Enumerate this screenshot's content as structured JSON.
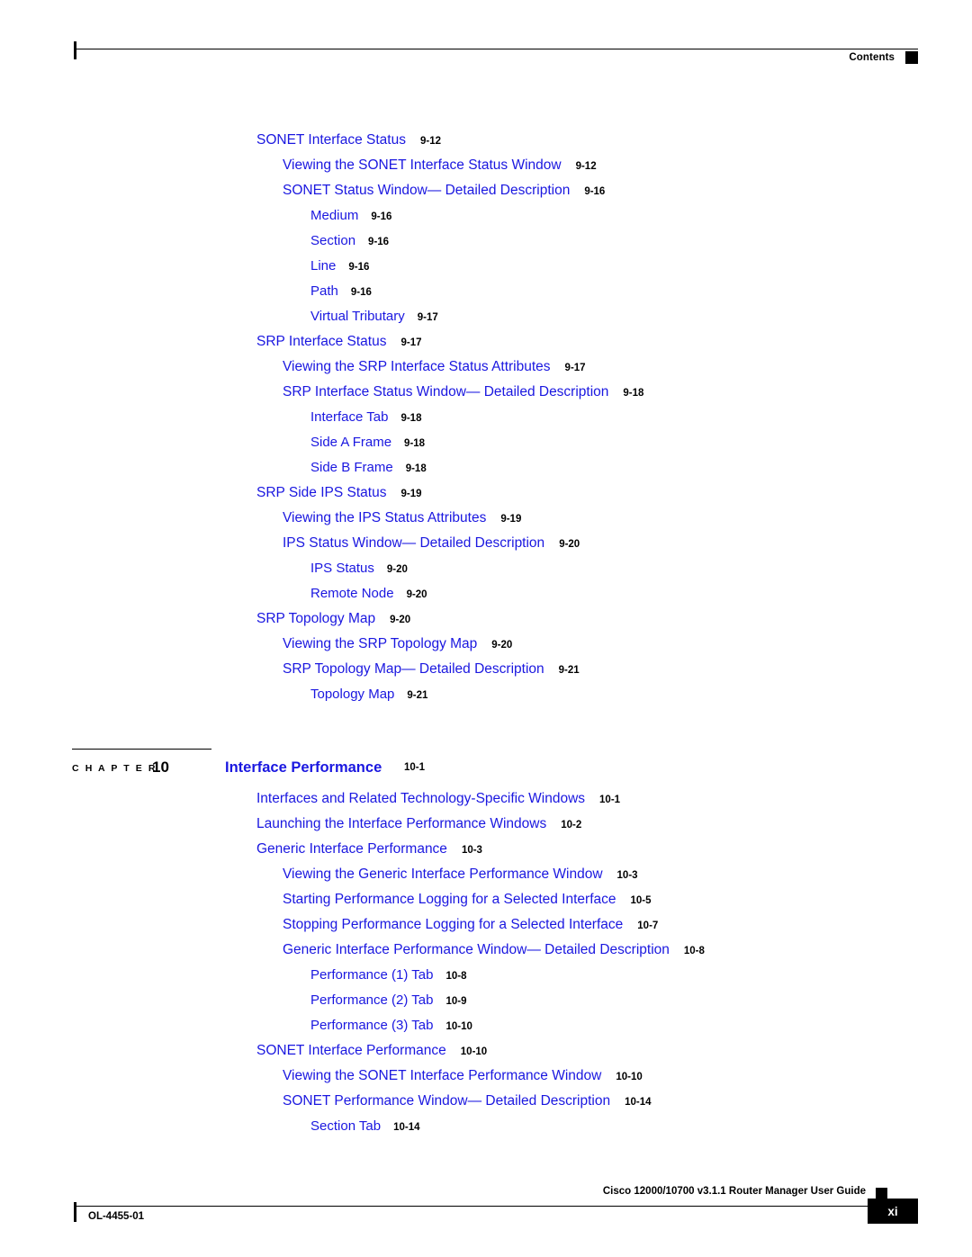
{
  "header": {
    "label": "Contents",
    "marker_icon": "black-square-icon"
  },
  "toc_section_9": {
    "entries": [
      {
        "level": 1,
        "title": "SONET Interface Status",
        "page": "9-12",
        "gap_before": false
      },
      {
        "level": 2,
        "title": "Viewing the SONET Interface Status Window",
        "page": "9-12",
        "gap_before": false
      },
      {
        "level": 2,
        "title": "SONET Status Window— Detailed Description",
        "page": "9-16",
        "gap_before": false
      },
      {
        "level": 3,
        "title": "Medium",
        "page": "9-16",
        "gap_before": false
      },
      {
        "level": 3,
        "title": "Section",
        "page": "9-16",
        "gap_before": false
      },
      {
        "level": 3,
        "title": "Line",
        "page": "9-16",
        "gap_before": false
      },
      {
        "level": 3,
        "title": "Path",
        "page": "9-16",
        "gap_before": false
      },
      {
        "level": 3,
        "title": "Virtual Tributary",
        "page": "9-17",
        "gap_before": false
      },
      {
        "level": 1,
        "title": "SRP Interface Status",
        "page": "9-17",
        "gap_before": false
      },
      {
        "level": 2,
        "title": "Viewing the SRP Interface Status Attributes",
        "page": "9-17",
        "gap_before": false
      },
      {
        "level": 2,
        "title": "SRP Interface Status Window— Detailed Description",
        "page": "9-18",
        "gap_before": false
      },
      {
        "level": 3,
        "title": "Interface Tab",
        "page": "9-18",
        "gap_before": false
      },
      {
        "level": 3,
        "title": "Side A Frame",
        "page": "9-18",
        "gap_before": false
      },
      {
        "level": 3,
        "title": "Side B Frame",
        "page": "9-18",
        "gap_before": false
      },
      {
        "level": 1,
        "title": "SRP Side IPS Status",
        "page": "9-19",
        "gap_before": false
      },
      {
        "level": 2,
        "title": "Viewing the IPS Status Attributes",
        "page": "9-19",
        "gap_before": false
      },
      {
        "level": 2,
        "title": "IPS Status Window— Detailed Description",
        "page": "9-20",
        "gap_before": false
      },
      {
        "level": 3,
        "title": "IPS Status",
        "page": "9-20",
        "gap_before": false
      },
      {
        "level": 3,
        "title": "Remote Node",
        "page": "9-20",
        "gap_before": false
      },
      {
        "level": 1,
        "title": "SRP Topology Map",
        "page": "9-20",
        "gap_before": false
      },
      {
        "level": 2,
        "title": "Viewing the SRP Topology Map",
        "page": "9-20",
        "gap_before": false
      },
      {
        "level": 2,
        "title": "SRP Topology Map— Detailed Description",
        "page": "9-21",
        "gap_before": false
      },
      {
        "level": 3,
        "title": "Topology Map",
        "page": "9-21",
        "gap_before": false
      }
    ]
  },
  "chapter": {
    "word": "C H A P T E R",
    "number": "10",
    "title": "Interface Performance",
    "page": "10-1"
  },
  "toc_section_10": {
    "entries": [
      {
        "level": 1,
        "title": "Interfaces and Related Technology-Specific Windows",
        "page": "10-1",
        "gap_before": false
      },
      {
        "level": 1,
        "title": "Launching the Interface Performance Windows",
        "page": "10-2",
        "gap_before": false
      },
      {
        "level": 1,
        "title": "Generic Interface Performance",
        "page": "10-3",
        "gap_before": false
      },
      {
        "level": 2,
        "title": "Viewing the Generic Interface Performance Window",
        "page": "10-3",
        "gap_before": false
      },
      {
        "level": 2,
        "title": "Starting Performance Logging for a Selected Interface",
        "page": "10-5",
        "gap_before": false
      },
      {
        "level": 2,
        "title": "Stopping Performance Logging for a Selected Interface",
        "page": "10-7",
        "gap_before": false
      },
      {
        "level": 2,
        "title": "Generic Interface Performance Window— Detailed Description",
        "page": "10-8",
        "gap_before": false
      },
      {
        "level": 3,
        "title": "Performance (1) Tab",
        "page": "10-8",
        "gap_before": false
      },
      {
        "level": 3,
        "title": "Performance (2) Tab",
        "page": "10-9",
        "gap_before": false
      },
      {
        "level": 3,
        "title": "Performance (3) Tab",
        "page": "10-10",
        "gap_before": false
      },
      {
        "level": 1,
        "title": "SONET Interface Performance",
        "page": "10-10",
        "gap_before": false
      },
      {
        "level": 2,
        "title": "Viewing the SONET Interface Performance Window",
        "page": "10-10",
        "gap_before": false
      },
      {
        "level": 2,
        "title": "SONET Performance Window— Detailed Description",
        "page": "10-14",
        "gap_before": false
      },
      {
        "level": 3,
        "title": "Section Tab",
        "page": "10-14",
        "gap_before": false
      }
    ]
  },
  "footer": {
    "doc_id": "OL-4455-01",
    "guide_title": "Cisco 12000/10700 v3.1.1 Router Manager User Guide",
    "page_number": "xi",
    "marker_icon": "black-square-icon"
  },
  "colors": {
    "link_blue": "#1a17e0",
    "text_black": "#000000",
    "page_bg": "#ffffff"
  }
}
